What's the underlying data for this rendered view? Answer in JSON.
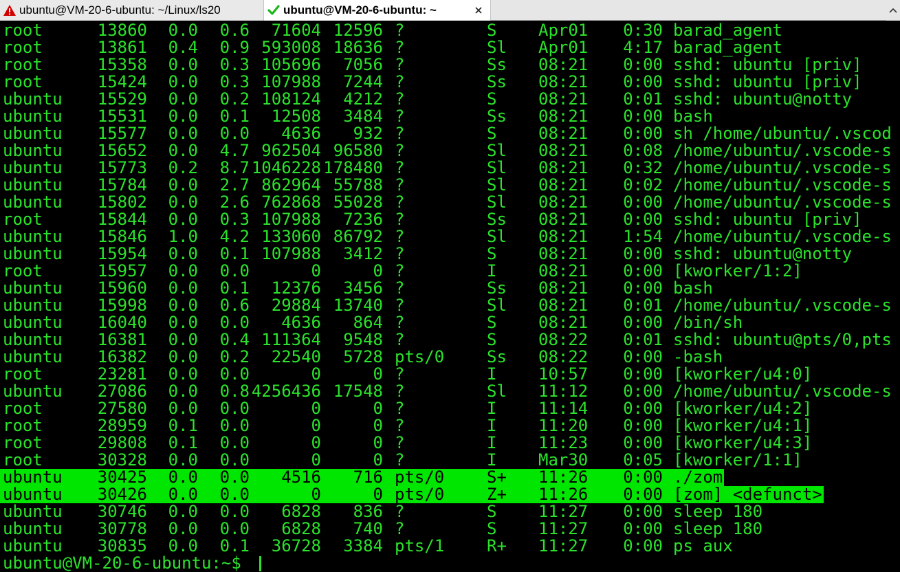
{
  "tabs": [
    {
      "label": "ubuntu@VM-20-6-ubuntu: ~/Linux/ls20",
      "icon": "warning-icon",
      "active": false
    },
    {
      "label": "ubuntu@VM-20-6-ubuntu: ~",
      "icon": "checkmark-icon",
      "active": true,
      "close_icon": "close-icon"
    }
  ],
  "colors": {
    "terminal_bg": "#000000",
    "terminal_fg": "#2be32b",
    "highlight_bg": "#00e600",
    "warning": "#d40000",
    "check": "#1bb51b"
  },
  "processes": [
    {
      "user": "root",
      "pid": "13860",
      "cpu": "0.0",
      "mem": "0.6",
      "vsz": "71604",
      "rss": "12596",
      "tty": "?",
      "stat": "S",
      "start": "Apr01",
      "time": "0:30",
      "command": "barad_agent"
    },
    {
      "user": "root",
      "pid": "13861",
      "cpu": "0.4",
      "mem": "0.9",
      "vsz": "593008",
      "rss": "18636",
      "tty": "?",
      "stat": "Sl",
      "start": "Apr01",
      "time": "4:17",
      "command": "barad_agent"
    },
    {
      "user": "root",
      "pid": "15358",
      "cpu": "0.0",
      "mem": "0.3",
      "vsz": "105696",
      "rss": "7056",
      "tty": "?",
      "stat": "Ss",
      "start": "08:21",
      "time": "0:00",
      "command": "sshd: ubuntu [priv]"
    },
    {
      "user": "root",
      "pid": "15424",
      "cpu": "0.0",
      "mem": "0.3",
      "vsz": "107988",
      "rss": "7244",
      "tty": "?",
      "stat": "Ss",
      "start": "08:21",
      "time": "0:00",
      "command": "sshd: ubuntu [priv]"
    },
    {
      "user": "ubuntu",
      "pid": "15529",
      "cpu": "0.0",
      "mem": "0.2",
      "vsz": "108124",
      "rss": "4212",
      "tty": "?",
      "stat": "S",
      "start": "08:21",
      "time": "0:01",
      "command": "sshd: ubuntu@notty"
    },
    {
      "user": "ubuntu",
      "pid": "15531",
      "cpu": "0.0",
      "mem": "0.1",
      "vsz": "12508",
      "rss": "3484",
      "tty": "?",
      "stat": "Ss",
      "start": "08:21",
      "time": "0:00",
      "command": "bash"
    },
    {
      "user": "ubuntu",
      "pid": "15577",
      "cpu": "0.0",
      "mem": "0.0",
      "vsz": "4636",
      "rss": "932",
      "tty": "?",
      "stat": "S",
      "start": "08:21",
      "time": "0:00",
      "command": "sh /home/ubuntu/.vscod"
    },
    {
      "user": "ubuntu",
      "pid": "15652",
      "cpu": "0.0",
      "mem": "4.7",
      "vsz": "962504",
      "rss": "96580",
      "tty": "?",
      "stat": "Sl",
      "start": "08:21",
      "time": "0:08",
      "command": "/home/ubuntu/.vscode-s"
    },
    {
      "user": "ubuntu",
      "pid": "15773",
      "cpu": "0.2",
      "mem": "8.7",
      "vsz": "1046228",
      "rss": "178480",
      "tty": "?",
      "stat": "Sl",
      "start": "08:21",
      "time": "0:32",
      "command": "/home/ubuntu/.vscode-s"
    },
    {
      "user": "ubuntu",
      "pid": "15784",
      "cpu": "0.0",
      "mem": "2.7",
      "vsz": "862964",
      "rss": "55788",
      "tty": "?",
      "stat": "Sl",
      "start": "08:21",
      "time": "0:02",
      "command": "/home/ubuntu/.vscode-s"
    },
    {
      "user": "ubuntu",
      "pid": "15802",
      "cpu": "0.0",
      "mem": "2.6",
      "vsz": "762868",
      "rss": "55028",
      "tty": "?",
      "stat": "Sl",
      "start": "08:21",
      "time": "0:00",
      "command": "/home/ubuntu/.vscode-s"
    },
    {
      "user": "root",
      "pid": "15844",
      "cpu": "0.0",
      "mem": "0.3",
      "vsz": "107988",
      "rss": "7236",
      "tty": "?",
      "stat": "Ss",
      "start": "08:21",
      "time": "0:00",
      "command": "sshd: ubuntu [priv]"
    },
    {
      "user": "ubuntu",
      "pid": "15846",
      "cpu": "1.0",
      "mem": "4.2",
      "vsz": "133060",
      "rss": "86792",
      "tty": "?",
      "stat": "Sl",
      "start": "08:21",
      "time": "1:54",
      "command": "/home/ubuntu/.vscode-s"
    },
    {
      "user": "ubuntu",
      "pid": "15954",
      "cpu": "0.0",
      "mem": "0.1",
      "vsz": "107988",
      "rss": "3412",
      "tty": "?",
      "stat": "S",
      "start": "08:21",
      "time": "0:00",
      "command": "sshd: ubuntu@notty"
    },
    {
      "user": "root",
      "pid": "15957",
      "cpu": "0.0",
      "mem": "0.0",
      "vsz": "0",
      "rss": "0",
      "tty": "?",
      "stat": "I",
      "start": "08:21",
      "time": "0:00",
      "command": "[kworker/1:2]"
    },
    {
      "user": "ubuntu",
      "pid": "15960",
      "cpu": "0.0",
      "mem": "0.1",
      "vsz": "12376",
      "rss": "3456",
      "tty": "?",
      "stat": "Ss",
      "start": "08:21",
      "time": "0:00",
      "command": "bash"
    },
    {
      "user": "ubuntu",
      "pid": "15998",
      "cpu": "0.0",
      "mem": "0.6",
      "vsz": "29884",
      "rss": "13740",
      "tty": "?",
      "stat": "Sl",
      "start": "08:21",
      "time": "0:01",
      "command": "/home/ubuntu/.vscode-s"
    },
    {
      "user": "ubuntu",
      "pid": "16040",
      "cpu": "0.0",
      "mem": "0.0",
      "vsz": "4636",
      "rss": "864",
      "tty": "?",
      "stat": "S",
      "start": "08:21",
      "time": "0:00",
      "command": "/bin/sh"
    },
    {
      "user": "ubuntu",
      "pid": "16381",
      "cpu": "0.0",
      "mem": "0.4",
      "vsz": "111364",
      "rss": "9548",
      "tty": "?",
      "stat": "S",
      "start": "08:22",
      "time": "0:01",
      "command": "sshd: ubuntu@pts/0,pts"
    },
    {
      "user": "ubuntu",
      "pid": "16382",
      "cpu": "0.0",
      "mem": "0.2",
      "vsz": "22540",
      "rss": "5728",
      "tty": "pts/0",
      "stat": "Ss",
      "start": "08:22",
      "time": "0:00",
      "command": "-bash"
    },
    {
      "user": "root",
      "pid": "23281",
      "cpu": "0.0",
      "mem": "0.0",
      "vsz": "0",
      "rss": "0",
      "tty": "?",
      "stat": "I",
      "start": "10:57",
      "time": "0:00",
      "command": "[kworker/u4:0]"
    },
    {
      "user": "ubuntu",
      "pid": "27086",
      "cpu": "0.0",
      "mem": "0.8",
      "vsz": "4256436",
      "rss": "17548",
      "tty": "?",
      "stat": "Sl",
      "start": "11:12",
      "time": "0:00",
      "command": "/home/ubuntu/.vscode-s"
    },
    {
      "user": "root",
      "pid": "27580",
      "cpu": "0.0",
      "mem": "0.0",
      "vsz": "0",
      "rss": "0",
      "tty": "?",
      "stat": "I",
      "start": "11:14",
      "time": "0:00",
      "command": "[kworker/u4:2]"
    },
    {
      "user": "root",
      "pid": "28959",
      "cpu": "0.1",
      "mem": "0.0",
      "vsz": "0",
      "rss": "0",
      "tty": "?",
      "stat": "I",
      "start": "11:20",
      "time": "0:00",
      "command": "[kworker/u4:1]"
    },
    {
      "user": "root",
      "pid": "29808",
      "cpu": "0.1",
      "mem": "0.0",
      "vsz": "0",
      "rss": "0",
      "tty": "?",
      "stat": "I",
      "start": "11:23",
      "time": "0:00",
      "command": "[kworker/u4:3]"
    },
    {
      "user": "root",
      "pid": "30328",
      "cpu": "0.0",
      "mem": "0.0",
      "vsz": "0",
      "rss": "0",
      "tty": "?",
      "stat": "I",
      "start": "Mar30",
      "time": "0:05",
      "command": "[kworker/1:1]"
    },
    {
      "user": "ubuntu",
      "pid": "30425",
      "cpu": "0.0",
      "mem": "0.0",
      "vsz": "4516",
      "rss": "716",
      "tty": "pts/0",
      "stat": "S+",
      "start": "11:26",
      "time": "0:00",
      "command": "./zom",
      "highlighted": true
    },
    {
      "user": "ubuntu",
      "pid": "30426",
      "cpu": "0.0",
      "mem": "0.0",
      "vsz": "0",
      "rss": "0",
      "tty": "pts/0",
      "stat": "Z+",
      "start": "11:26",
      "time": "0:00",
      "command": "[zom] <defunct>",
      "highlighted": true
    },
    {
      "user": "ubuntu",
      "pid": "30746",
      "cpu": "0.0",
      "mem": "0.0",
      "vsz": "6828",
      "rss": "836",
      "tty": "?",
      "stat": "S",
      "start": "11:27",
      "time": "0:00",
      "command": "sleep 180"
    },
    {
      "user": "ubuntu",
      "pid": "30778",
      "cpu": "0.0",
      "mem": "0.0",
      "vsz": "6828",
      "rss": "740",
      "tty": "?",
      "stat": "S",
      "start": "11:27",
      "time": "0:00",
      "command": "sleep 180"
    },
    {
      "user": "ubuntu",
      "pid": "30835",
      "cpu": "0.0",
      "mem": "0.1",
      "vsz": "36728",
      "rss": "3384",
      "tty": "pts/1",
      "stat": "R+",
      "start": "11:27",
      "time": "0:00",
      "command": "ps aux"
    }
  ],
  "prompt": "ubuntu@VM-20-6-ubuntu:~$ "
}
